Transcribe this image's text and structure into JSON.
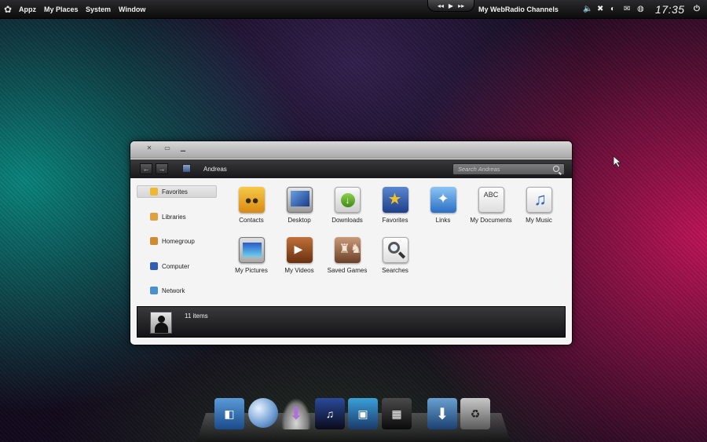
{
  "topbar": {
    "menu": [
      "Appz",
      "My Places",
      "System",
      "Window"
    ],
    "media_prev": "◂◂",
    "media_play": "▶",
    "media_next": "▸▸",
    "radio": "My WebRadio Channels",
    "clock": "17:35"
  },
  "window": {
    "breadcrumb": "Andreas",
    "search_placeholder": "Search Andreas",
    "sidebar": [
      {
        "label": "Favorites",
        "icon": "star-folder-icon",
        "color": "#f0b830"
      },
      {
        "label": "Libraries",
        "icon": "library-icon",
        "color": "#e0a040"
      },
      {
        "label": "Homegroup",
        "icon": "homegroup-icon",
        "color": "#d08a30"
      },
      {
        "label": "Computer",
        "icon": "computer-icon",
        "color": "#3060b0"
      },
      {
        "label": "Network",
        "icon": "network-icon",
        "color": "#4a90d0"
      }
    ],
    "items": [
      {
        "label": "Contacts",
        "icon": "contacts-icon"
      },
      {
        "label": "Desktop",
        "icon": "desktop-icon"
      },
      {
        "label": "Downloads",
        "icon": "downloads-icon"
      },
      {
        "label": "Favorites",
        "icon": "favorites-icon"
      },
      {
        "label": "Links",
        "icon": "links-icon"
      },
      {
        "label": "My Documents",
        "icon": "documents-icon",
        "glyph": "ABC"
      },
      {
        "label": "My Music",
        "icon": "music-icon"
      },
      {
        "label": "My Pictures",
        "icon": "pictures-icon"
      },
      {
        "label": "My Videos",
        "icon": "videos-icon"
      },
      {
        "label": "Saved Games",
        "icon": "games-icon"
      },
      {
        "label": "Searches",
        "icon": "searches-icon"
      }
    ],
    "item_count": "11 items"
  },
  "dock": [
    "finder-icon",
    "globe-icon",
    "download-arrow-icon",
    "music-globe-icon",
    "photos-icon",
    "video-icon",
    "download-icon",
    "trash-icon"
  ]
}
